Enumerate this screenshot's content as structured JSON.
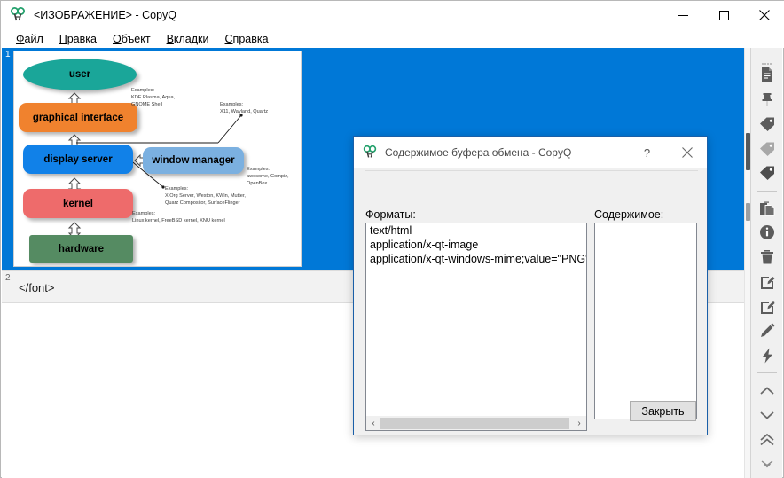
{
  "window": {
    "title": "<ИЗОБРАЖЕНИЕ> - CopyQ",
    "icon": "copyq-logo-icon",
    "controls": {
      "minimize": "–",
      "maximize": "□",
      "close": "✕"
    }
  },
  "menubar": {
    "items": [
      {
        "mnemonic": "Ф",
        "rest": "айл"
      },
      {
        "mnemonic": "П",
        "rest": "равка"
      },
      {
        "mnemonic": "О",
        "rest": "бъект"
      },
      {
        "mnemonic": "В",
        "rest": "кладки"
      },
      {
        "mnemonic": "С",
        "rest": "правка"
      }
    ]
  },
  "items": [
    {
      "number": "1",
      "type": "image",
      "selected": true
    },
    {
      "number": "2",
      "type": "text",
      "text": "</font>",
      "selected": false
    }
  ],
  "diagram": {
    "nodes": [
      {
        "id": "user",
        "label": "user",
        "color": "#1aa699"
      },
      {
        "id": "gui",
        "label": "graphical interface",
        "color": "#f0822e"
      },
      {
        "id": "display-server",
        "label": "display server",
        "color": "#1181e8"
      },
      {
        "id": "window-manager",
        "label": "window manager",
        "color": "#7bb0e0"
      },
      {
        "id": "kernel",
        "label": "kernel",
        "color": "#ee6b6b"
      },
      {
        "id": "hardware",
        "label": "hardware",
        "color": "#558b62"
      }
    ],
    "annotations": {
      "gui": "Examples:\nKDE Plasma, Aqua,\nGNOME Shell",
      "display_stack": "Examples:\nX11, Wayland, Quartz",
      "window_manager": "Examples:\nawesome, Compiz,\nOpenBox",
      "display_server": "Examples:\nX.Org Server, Weston, KWin, Mutter,\nQuarz Compositor, SurfaceFlinger",
      "kernel": "Examples:\nLinux kernel, FreeBSD kernel, XNU kernel"
    }
  },
  "toolbar": {
    "buttons": [
      {
        "name": "new-item-icon",
        "title": "new"
      },
      {
        "name": "pin-icon",
        "title": "pin"
      },
      {
        "name": "tag-icon",
        "title": "tag"
      },
      {
        "name": "tag-light-icon",
        "title": "tag-light"
      },
      {
        "name": "tag-dark-icon",
        "title": "tag-dark"
      },
      {
        "name": "paste-icon",
        "title": "paste"
      },
      {
        "name": "info-icon",
        "title": "info"
      },
      {
        "name": "trash-icon",
        "title": "trash"
      },
      {
        "name": "edit-square-icon",
        "title": "edit"
      },
      {
        "name": "edit-square-alt-icon",
        "title": "edit-alt"
      },
      {
        "name": "pencil-icon",
        "title": "pencil"
      },
      {
        "name": "lightning-icon",
        "title": "action"
      },
      {
        "name": "chevron-up-icon",
        "title": "up"
      },
      {
        "name": "chevron-down-icon",
        "title": "down"
      },
      {
        "name": "double-chevron-up-icon",
        "title": "top"
      },
      {
        "name": "double-chevron-down-icon",
        "title": "bottom"
      }
    ]
  },
  "dialog": {
    "title": "Содержимое буфера обмена - CopyQ",
    "icon": "copyq-logo-icon",
    "help_label": "?",
    "close_label": "✕",
    "formats_label": "Форматы:",
    "content_label": "Содержимое:",
    "formats": [
      "text/html",
      "application/x-qt-image",
      "application/x-qt-windows-mime;value=\"PNG\""
    ],
    "content_value": "",
    "close_button": "Закрыть",
    "scroll_left": "‹",
    "scroll_right": "›"
  },
  "colors": {
    "selection_blue": "#0078d7",
    "dialog_border": "#1a5fa8",
    "toolbar_bg": "#f0f0f0"
  }
}
